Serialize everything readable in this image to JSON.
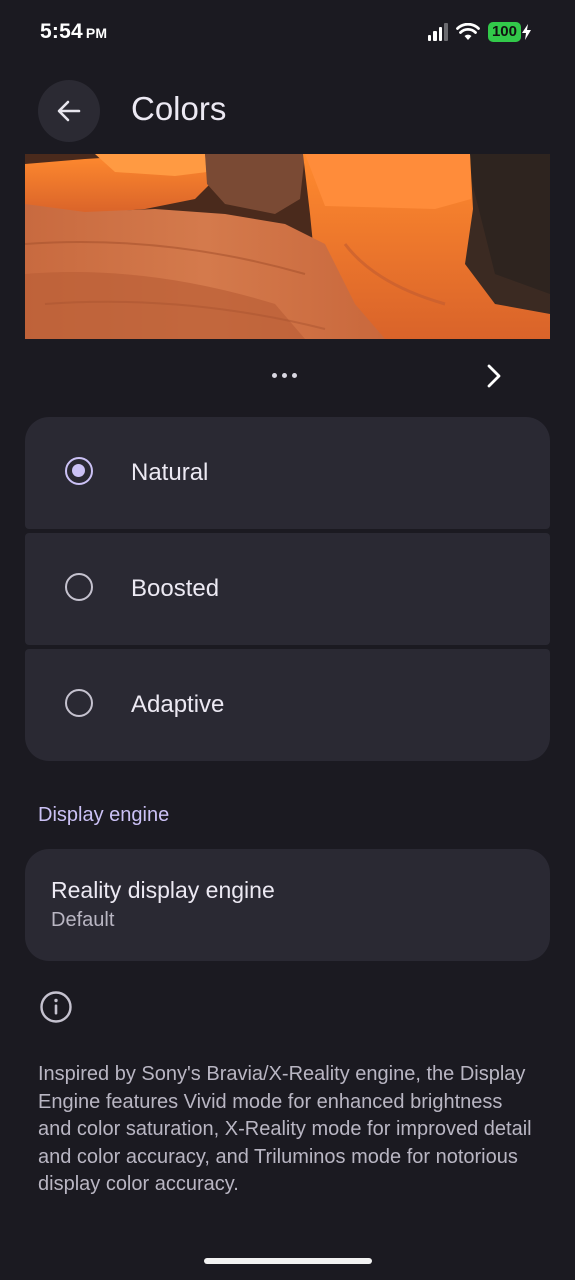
{
  "status_bar": {
    "time": "5:54",
    "ampm": "PM",
    "battery": "100"
  },
  "header": {
    "title": "Colors",
    "back_icon": "arrow-left-icon"
  },
  "preview": {
    "image": "red-rock-arch-photo"
  },
  "pager": {
    "next_icon": "chevron-right-icon"
  },
  "color_modes": {
    "options": [
      {
        "label": "Natural",
        "selected": true
      },
      {
        "label": "Boosted",
        "selected": false
      },
      {
        "label": "Adaptive",
        "selected": false
      }
    ]
  },
  "display_engine": {
    "section_title": "Display engine",
    "item_title": "Reality display engine",
    "item_value": "Default"
  },
  "info": {
    "icon": "info-icon",
    "text": "Inspired by Sony's Bravia/X-Reality engine, the Display Engine features Vivid mode for enhanced brightness and color saturation, X-Reality mode for improved detail and color accuracy, and Triluminos mode for notorious display color accuracy."
  },
  "colors": {
    "background": "#1b1a21",
    "card": "#2a2933",
    "accent": "#cbc1f5",
    "battery": "#32c94a"
  }
}
